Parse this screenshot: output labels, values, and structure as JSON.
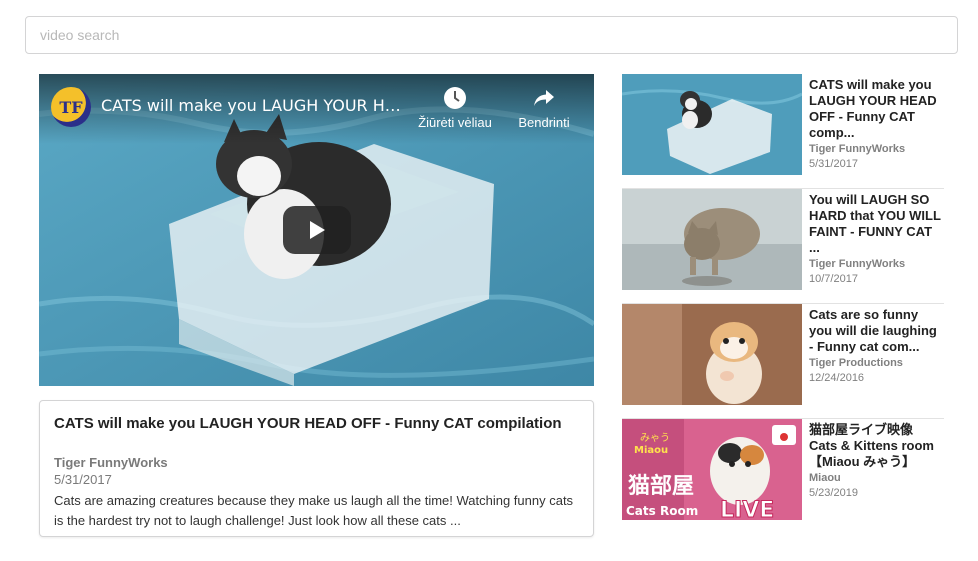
{
  "search": {
    "placeholder": "video search"
  },
  "player": {
    "channel_logo_text": "TF",
    "title": "CATS will make you LAUGH YOUR HEAD OFF - Funny CAT compilation",
    "watch_later_label": "Žiūrėti vėliau",
    "share_label": "Bendrinti"
  },
  "details": {
    "title": "CATS will make you LAUGH YOUR HEAD OFF - Funny CAT compilation",
    "channel": "Tiger FunnyWorks",
    "date": "5/31/2017",
    "description": "Cats are amazing creatures because they make us laugh all the time! Watching funny cats is the hardest try not to laugh challenge! Just look how all these cats ..."
  },
  "related": [
    {
      "title": "CATS will make you LAUGH YOUR HEAD OFF - Funny CAT comp...",
      "channel": "Tiger FunnyWorks",
      "date": "5/31/2017"
    },
    {
      "title": "You will LAUGH SO HARD that YOU WILL FAINT - FUNNY CAT ...",
      "channel": "Tiger FunnyWorks",
      "date": "10/7/2017"
    },
    {
      "title": "Cats are so funny you will die laughing - Funny cat com...",
      "channel": "Tiger Productions",
      "date": "12/24/2016"
    },
    {
      "title": "猫部屋ライブ映像 Cats & Kittens room【Miaou みゃう】",
      "channel": "Miaou",
      "date": "5/23/2019"
    }
  ],
  "thumb4": {
    "top_text": "みゃう",
    "mid_text": "Miaou",
    "big_text": "猫部屋",
    "room_text": "Cats Room",
    "live_text": "LIVE"
  }
}
